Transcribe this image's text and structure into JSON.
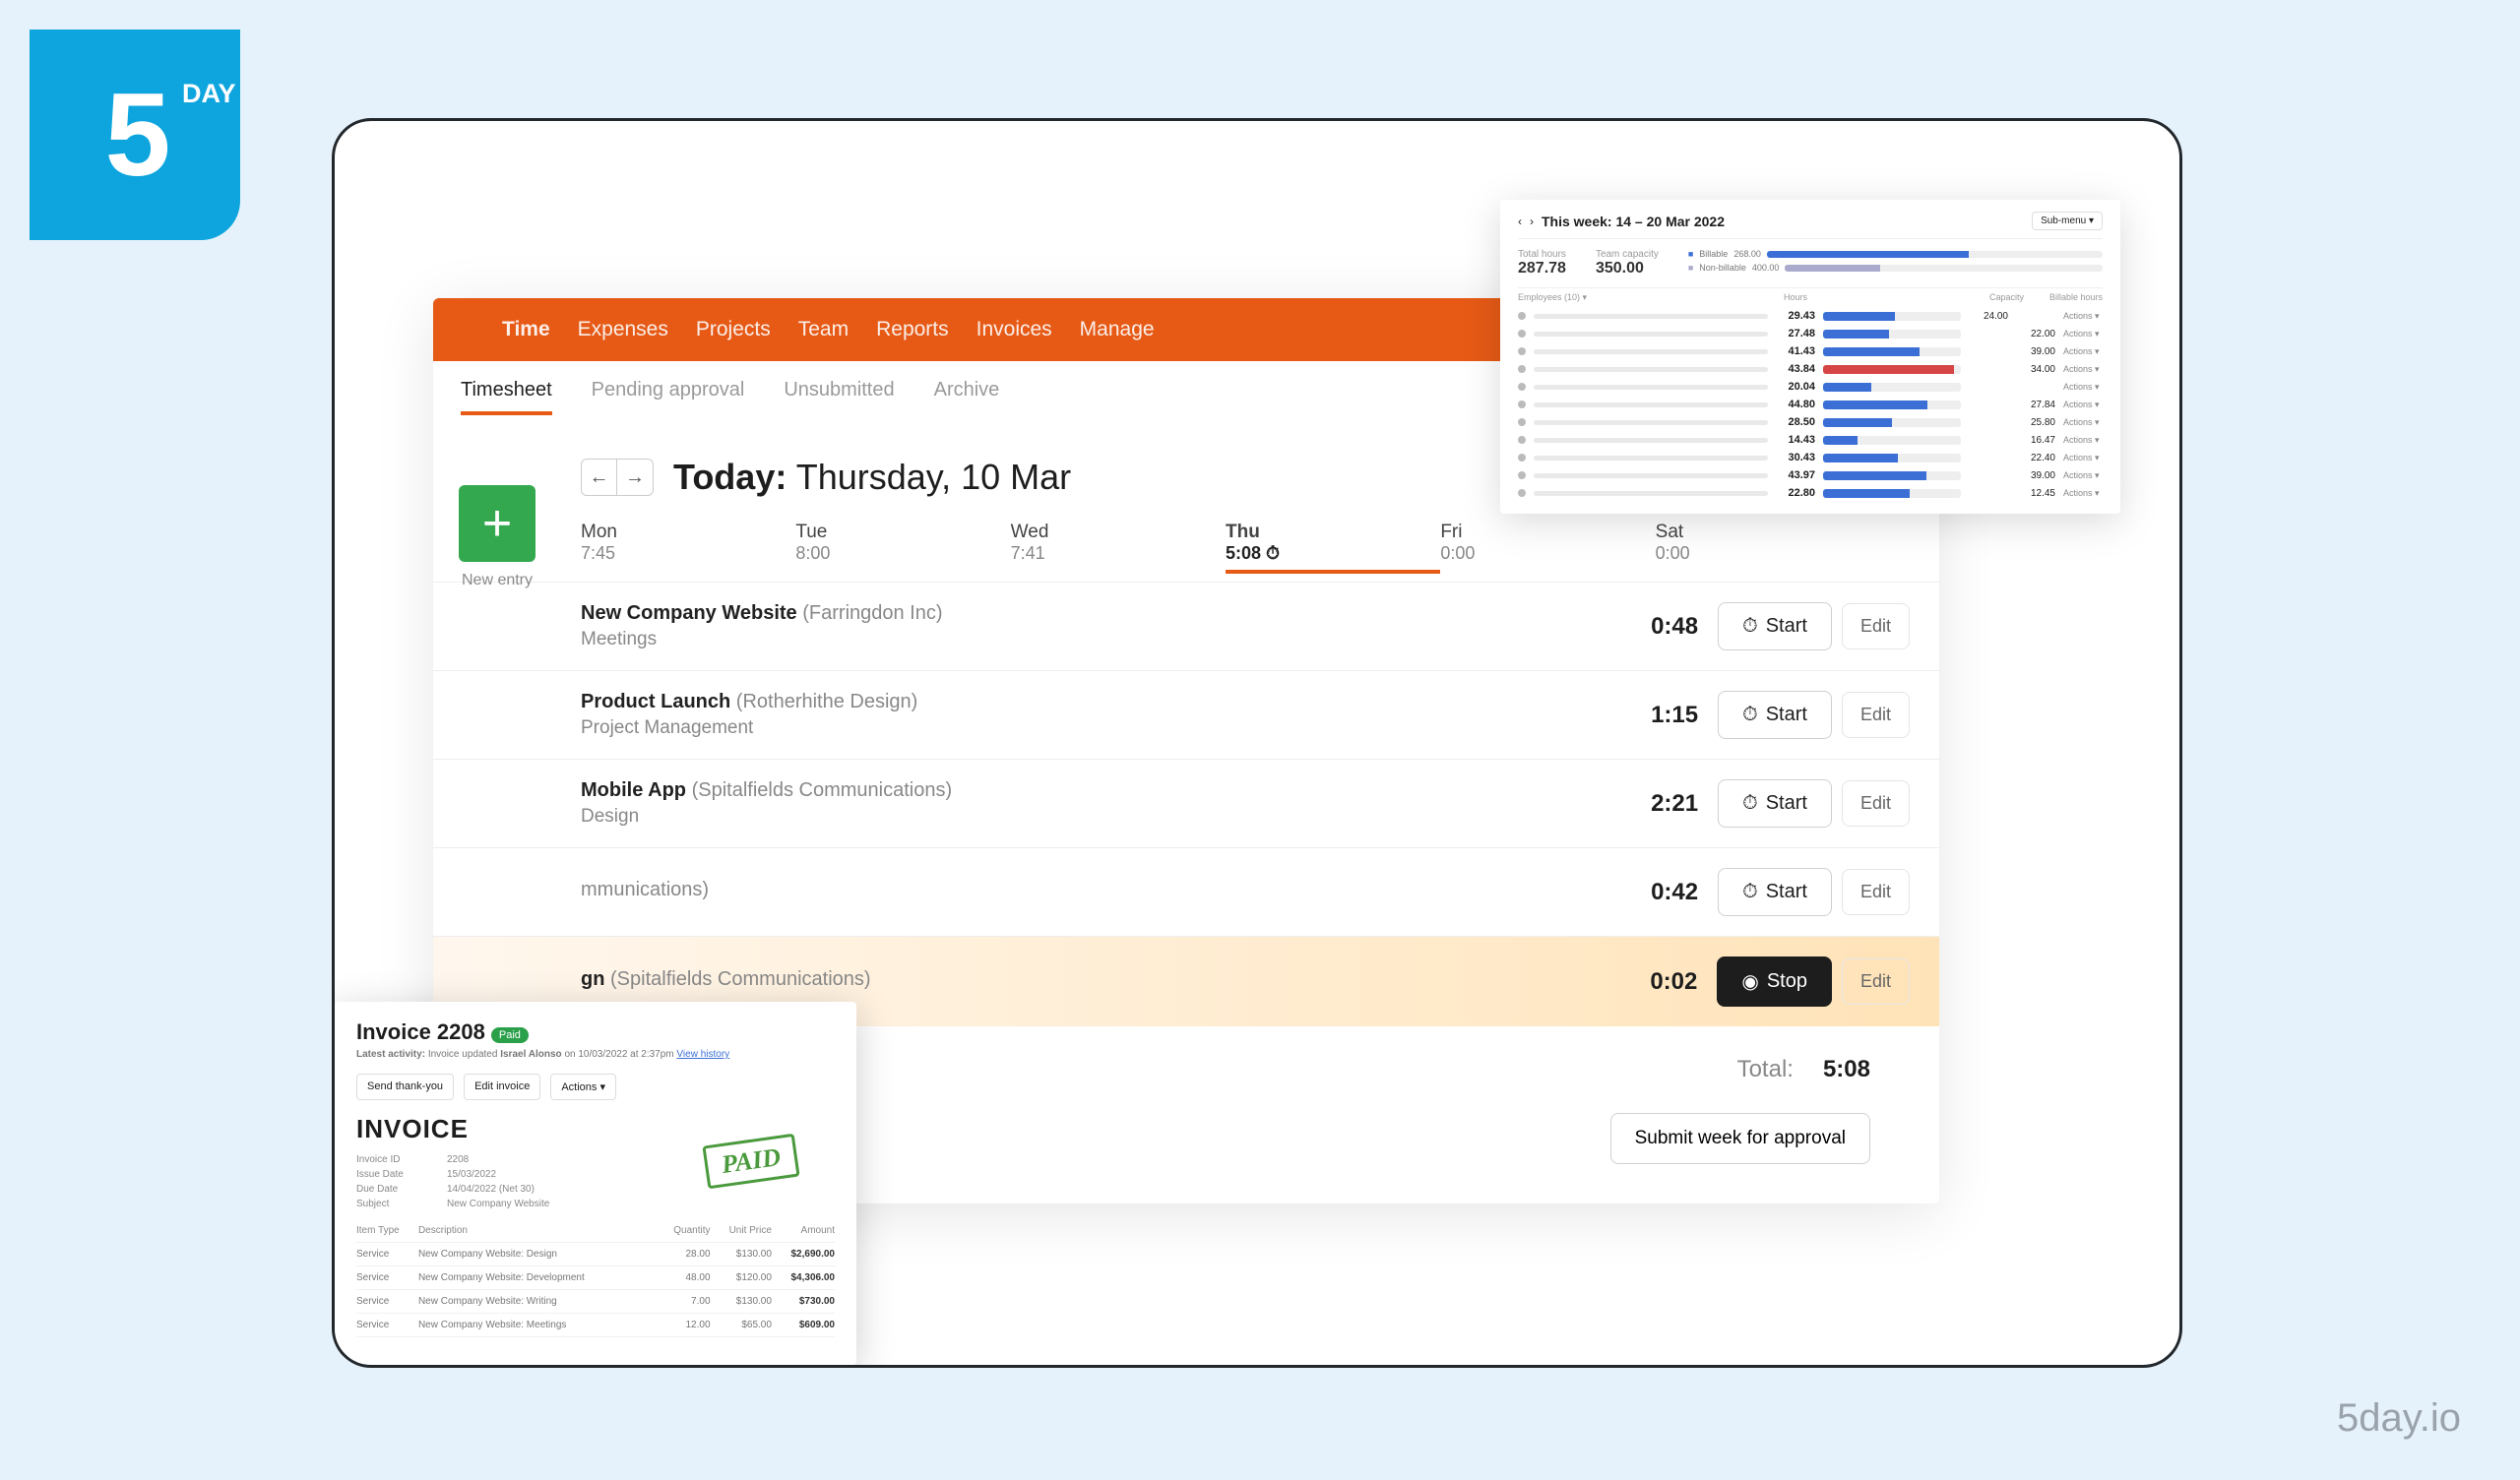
{
  "brand": {
    "logo_text": "5",
    "day": "DAY",
    "footer": "5day.io"
  },
  "topnav": {
    "items": [
      "Time",
      "Expenses",
      "Projects",
      "Team",
      "Reports",
      "Invoices",
      "Manage"
    ],
    "active": 0
  },
  "subnav": {
    "items": [
      "Timesheet",
      "Pending approval",
      "Unsubmitted",
      "Archive"
    ],
    "active": 0
  },
  "date": {
    "today_label": "Today:",
    "today_value": "Thursday, 10 Mar"
  },
  "add": {
    "label": "New entry"
  },
  "days": [
    {
      "d": "Mon",
      "h": "7:45"
    },
    {
      "d": "Tue",
      "h": "8:00"
    },
    {
      "d": "Wed",
      "h": "7:41"
    },
    {
      "d": "Thu",
      "h": "5:08",
      "active": true,
      "timer": true
    },
    {
      "d": "Fri",
      "h": "0:00"
    },
    {
      "d": "Sat",
      "h": "0:00"
    }
  ],
  "entries": [
    {
      "project": "New Company Website",
      "client": "(Farringdon Inc)",
      "task": "Meetings",
      "dur": "0:48",
      "btn": "Start",
      "edit": "Edit"
    },
    {
      "project": "Product Launch",
      "client": "(Rotherhithe Design)",
      "task": "Project Management",
      "dur": "1:15",
      "btn": "Start",
      "edit": "Edit"
    },
    {
      "project": "Mobile App",
      "client": "(Spitalfields Communications)",
      "task": "Design",
      "dur": "2:21",
      "btn": "Start",
      "edit": "Edit"
    },
    {
      "project": "",
      "client": "mmunications)",
      "task": "",
      "dur": "0:42",
      "btn": "Start",
      "edit": "Edit"
    },
    {
      "project": "gn",
      "client": "(Spitalfields Communications)",
      "task": "",
      "dur": "0:02",
      "btn": "Stop",
      "edit": "Edit",
      "running": true
    }
  ],
  "total": {
    "label": "Total:",
    "value": "5:08"
  },
  "submit": {
    "label": "Submit week for approval"
  },
  "report": {
    "week": "This week: 14 – 20 Mar 2022",
    "export": "Sub-menu ▾",
    "total_hours_label": "Total hours",
    "total_hours": "287.78",
    "team_capacity_label": "Team capacity",
    "team_capacity": "350.00",
    "legend_b": "Billable",
    "legend_n": "Non-billable",
    "sum_b": "268.00",
    "sum_n": "400.00",
    "headers": {
      "name": "Employees (10) ▾",
      "hours": "Hours",
      "capacity": "Capacity",
      "billable": "Billable hours"
    },
    "rows": [
      {
        "h": "29.43",
        "w": 52,
        "c": "24.00",
        "bh": "",
        "a": "Actions ▾"
      },
      {
        "h": "27.48",
        "w": 48,
        "c": "",
        "bh": "22.00",
        "a": "Actions ▾"
      },
      {
        "h": "41.43",
        "w": 70,
        "c": "",
        "bh": "39.00",
        "a": "Actions ▾"
      },
      {
        "h": "43.84",
        "w": 95,
        "red": true,
        "c": "",
        "bh": "34.00",
        "a": "Actions ▾"
      },
      {
        "h": "20.04",
        "w": 35,
        "c": "",
        "bh": "",
        "a": "Actions ▾"
      },
      {
        "h": "44.80",
        "w": 76,
        "c": "",
        "bh": "27.84",
        "a": "Actions ▾"
      },
      {
        "h": "28.50",
        "w": 50,
        "c": "",
        "bh": "25.80",
        "a": "Actions ▾"
      },
      {
        "h": "14.43",
        "w": 25,
        "c": "",
        "bh": "16.47",
        "a": "Actions ▾"
      },
      {
        "h": "30.43",
        "w": 54,
        "c": "",
        "bh": "22.40",
        "a": "Actions ▾"
      },
      {
        "h": "43.97",
        "w": 75,
        "c": "",
        "bh": "39.00",
        "a": "Actions ▾"
      },
      {
        "h": "22.80",
        "w": 63,
        "c": "",
        "bh": "12.45",
        "a": "Actions ▾"
      }
    ]
  },
  "invoice": {
    "title": "Invoice 2208",
    "badge": "Paid",
    "activity_pre": "Latest activity:",
    "activity": "Invoice updated",
    "by": "Israel Alonso",
    "on": "on 10/03/2022 at 2:37pm",
    "history": "View history",
    "actions": [
      "Send thank-you",
      "Edit invoice",
      "Actions ▾"
    ],
    "heading": "INVOICE",
    "stamp": "PAID",
    "meta": [
      [
        "Invoice ID",
        "2208"
      ],
      [
        "Issue Date",
        "15/03/2022"
      ],
      [
        "Due Date",
        "14/04/2022 (Net 30)"
      ],
      [
        "Subject",
        "New Company Website"
      ]
    ],
    "thead": [
      "Item Type",
      "Description",
      "Quantity",
      "Unit Price",
      "Amount"
    ],
    "lines": [
      [
        "Service",
        "New Company Website: Design",
        "28.00",
        "$130.00",
        "$2,690.00"
      ],
      [
        "Service",
        "New Company Website: Development",
        "48.00",
        "$120.00",
        "$4,306.00"
      ],
      [
        "Service",
        "New Company Website: Writing",
        "7.00",
        "$130.00",
        "$730.00"
      ],
      [
        "Service",
        "New Company Website: Meetings",
        "12.00",
        "$65.00",
        "$609.00"
      ]
    ]
  }
}
